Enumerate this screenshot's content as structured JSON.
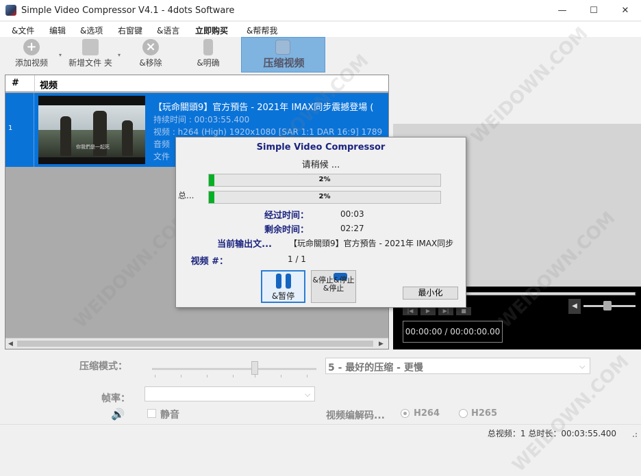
{
  "window": {
    "title": "Simple Video Compressor V4.1 - 4dots Software",
    "minimize": "—",
    "maximize": "☐",
    "close": "✕"
  },
  "menu": {
    "items": [
      "&文件",
      "编辑",
      "&选项",
      "右窗键",
      "&语言",
      "立即购买",
      "&帮帮我"
    ]
  },
  "toolbar": {
    "add_video": "添加视频",
    "add_folder": "新增文件 夹",
    "remove": "&移除",
    "clear": "&明确",
    "compress": "压缩视频",
    "add_icon": "plus-icon",
    "remove_icon": "x-icon"
  },
  "list": {
    "col_num": "#",
    "col_video": "视频",
    "row": {
      "num": "1",
      "title": "【玩命關頭9】官方預告 - 2021年 IMAX同步震撼登場 (",
      "duration": "持续时间 : 00:03:55.400",
      "video": "视频 : h264 (High) 1920x1080 [SAR 1:1 DAR 16:9] 1789",
      "audio": "音频",
      "file": "文件",
      "thumb_caption": "你我們是一起死"
    }
  },
  "player": {
    "time": "00:00:00 / 00:00:00.00"
  },
  "dialog": {
    "title": "Simple Video Compressor",
    "wait": "请稍候 ...",
    "progress1": "2%",
    "progress1_value": 0.02,
    "progress2": "2%",
    "progress2_value": 0.02,
    "total_label": "总...",
    "elapsed_label": "经过时间：",
    "elapsed_value": "00:03",
    "remaining_label": "剩余时间：",
    "remaining_value": "02:27",
    "output_label": "当前输出文...",
    "output_value": "【玩命關頭9】官方預告 - 2021年 IMAX同步",
    "video_count_label": "视频 #：",
    "video_count_value": "1 / 1",
    "pause": "&暂停",
    "stop": "&停止&停止&停止",
    "minimize": "最小化"
  },
  "settings": {
    "mode_label": "压缩模式：",
    "mode_value": "5 - 最好的压缩 - 更慢",
    "fps_label": "帧率：",
    "fps_value": "",
    "mute_label": "静音",
    "codec_label": "视频编解码...",
    "h264": "H264",
    "h265": "H265"
  },
  "status": {
    "text": "总视频：1   总时长：00:03:55.400"
  },
  "watermark": "WEIDOWN.COM",
  "colors": {
    "selection": "#0a73d8",
    "progress": "#06b025",
    "dialog_label": "#1a237e"
  }
}
